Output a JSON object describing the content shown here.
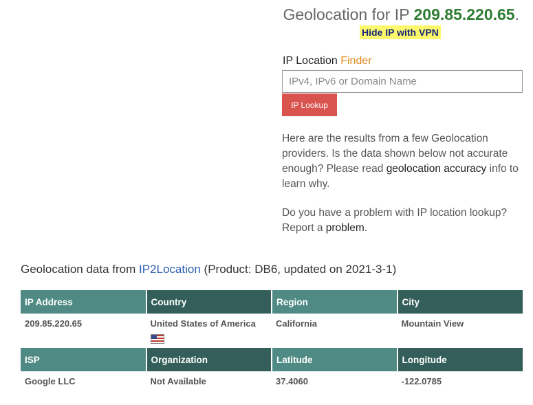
{
  "header": {
    "title_prefix": "Geolocation for IP",
    "ip": "209.85.220.65",
    "title_suffix": ".",
    "vpn_link": "Hide IP with VPN"
  },
  "finder": {
    "label": "IP Location",
    "label_accent": "Finder",
    "placeholder": "IPv4, IPv6 or Domain Name",
    "button": "IP Lookup"
  },
  "info": {
    "p1_text": "Here are the results from a few Geolocation providers. Is the data shown below not accurate enough? Please read",
    "p1_link": "geolocation accuracy",
    "p1_tail": "info to learn why.",
    "p2_text": "Do you have a problem with IP location lookup? Report a",
    "p2_link": "problem",
    "p2_tail": "."
  },
  "provider": {
    "prefix": "Geolocation data from",
    "name": "IP2Location",
    "suffix": "(Product: DB6, updated on 2021-3-1)"
  },
  "table": {
    "headers1": [
      "IP Address",
      "Country",
      "Region",
      "City"
    ],
    "row1": [
      "209.85.220.65",
      "United States of America",
      "California",
      "Mountain View"
    ],
    "headers2": [
      "ISP",
      "Organization",
      "Latitude",
      "Longitude"
    ],
    "row2": [
      "Google LLC",
      "Not Available",
      "37.4060",
      "-122.0785"
    ],
    "flag_icon": "us-flag-icon"
  }
}
